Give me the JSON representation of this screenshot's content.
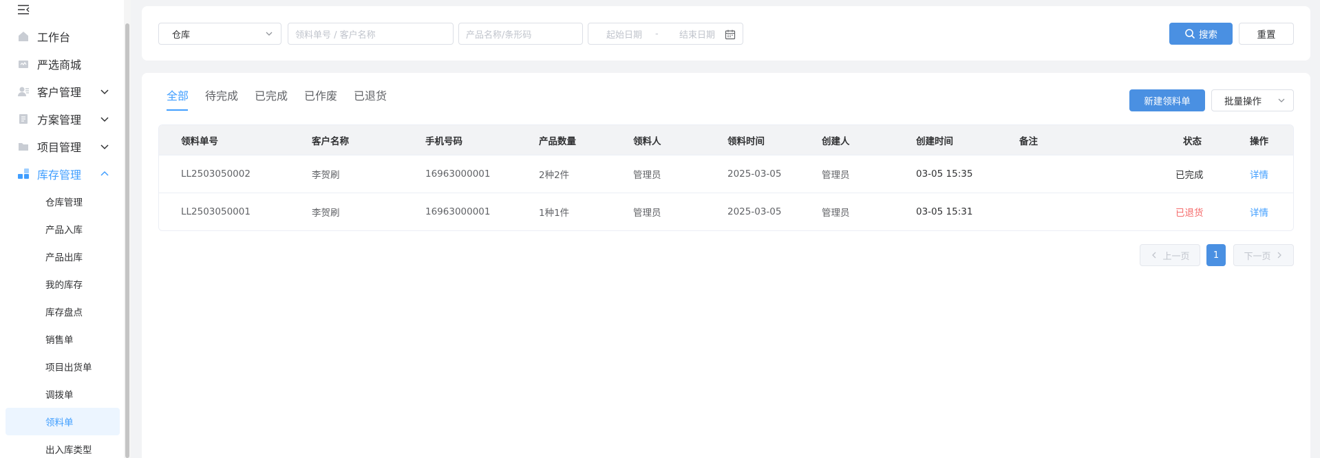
{
  "sidebar": {
    "menu": [
      {
        "label": "工作台",
        "icon": "home-icon"
      },
      {
        "label": "严选商城",
        "icon": "shop-icon"
      },
      {
        "label": "客户管理",
        "icon": "customer-icon"
      },
      {
        "label": "方案管理",
        "icon": "document-icon"
      },
      {
        "label": "项目管理",
        "icon": "folder-icon"
      },
      {
        "label": "库存管理",
        "icon": "inventory-icon"
      }
    ],
    "submenu": [
      {
        "label": "仓库管理"
      },
      {
        "label": "产品入库"
      },
      {
        "label": "产品出库"
      },
      {
        "label": "我的库存"
      },
      {
        "label": "库存盘点"
      },
      {
        "label": "销售单"
      },
      {
        "label": "项目出货单"
      },
      {
        "label": "调拨单"
      },
      {
        "label": "领料单"
      },
      {
        "label": "出入库类型"
      }
    ]
  },
  "filters": {
    "warehouse_value": "仓库",
    "order_placeholder": "领料单号 / 客户名称",
    "product_placeholder": "产品名称/条形码",
    "start_date_placeholder": "起始日期",
    "date_separator": "-",
    "end_date_placeholder": "结束日期",
    "search_label": "搜索",
    "reset_label": "重置"
  },
  "tabs": [
    {
      "label": "全部"
    },
    {
      "label": "待完成"
    },
    {
      "label": "已完成"
    },
    {
      "label": "已作废"
    },
    {
      "label": "已退货"
    }
  ],
  "actions": {
    "new_label": "新建领料单",
    "batch_label": "批量操作"
  },
  "table": {
    "headers": [
      "领料单号",
      "客户名称",
      "手机号码",
      "产品数量",
      "领料人",
      "领料时间",
      "创建人",
      "创建时间",
      "备注",
      "状态",
      "操作"
    ],
    "rows": [
      {
        "order": "LL2503050002",
        "customer": "李贺刷",
        "phone": "16963000001",
        "qty": "2种2件",
        "picker": "管理员",
        "pick_time": "2025-03-05",
        "creator": "管理员",
        "created": "03-05 15:35",
        "note": "",
        "status": "已完成",
        "action": "详情"
      },
      {
        "order": "LL2503050001",
        "customer": "李贺刷",
        "phone": "16963000001",
        "qty": "1种1件",
        "picker": "管理员",
        "pick_time": "2025-03-05",
        "creator": "管理员",
        "created": "03-05 15:31",
        "note": "",
        "status": "已退货",
        "action": "详情"
      }
    ]
  },
  "pagination": {
    "prev_label": "上一页",
    "current": "1",
    "next_label": "下一页"
  },
  "colors": {
    "accent": "#409eff",
    "primary_button": "#4a90e2",
    "status_returned": "#f56c6c"
  }
}
